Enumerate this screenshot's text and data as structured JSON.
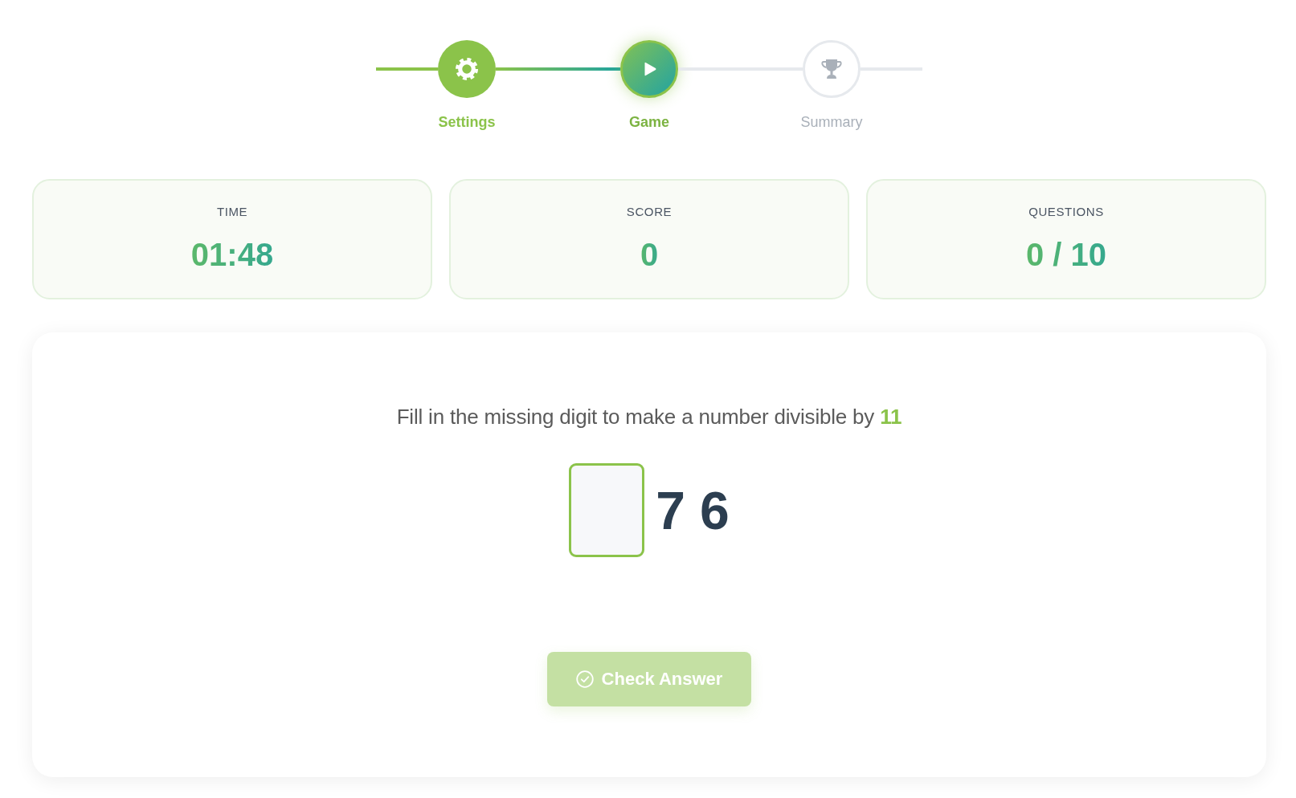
{
  "stepper": {
    "steps": [
      {
        "label": "Settings",
        "completed": true,
        "selected": false
      },
      {
        "label": "Game",
        "completed": false,
        "selected": true
      },
      {
        "label": "Summary",
        "completed": false,
        "selected": false
      }
    ]
  },
  "stats": [
    {
      "label": "TIME",
      "value": "01:48"
    },
    {
      "label": "SCORE",
      "value": "0"
    },
    {
      "label": "QUESTIONS",
      "value": "0 / 10"
    }
  ],
  "question": {
    "prompt": "Fill in the missing digit to make a number divisible by **11**",
    "digits": [
      {
        "kind": "blank"
      },
      {
        "kind": "digit",
        "text": "7"
      },
      {
        "kind": "digit",
        "text": "6"
      }
    ]
  },
  "check_button": {
    "label": "Check Answer",
    "disabled": true
  }
}
